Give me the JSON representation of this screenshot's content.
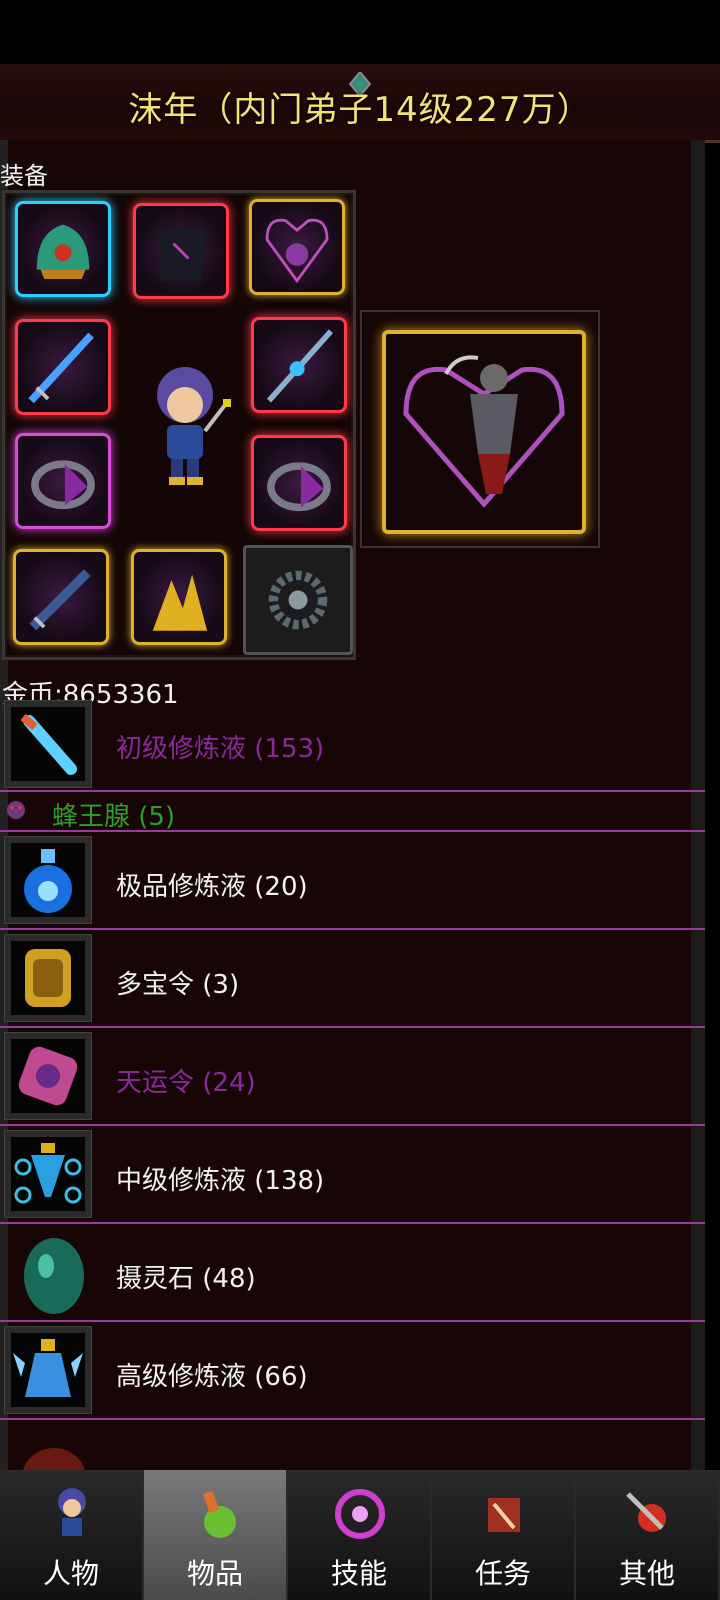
{
  "header": {
    "title": "沫年（内门弟子14级227万）"
  },
  "equipment": {
    "label": "装备"
  },
  "gold": {
    "text": "金币:8653361"
  },
  "items": [
    {
      "name": "初级修炼液 (153)",
      "color": "#8a2a9a",
      "icon": "blue-vial-icon"
    },
    {
      "name": "蜂王腺 (5)",
      "color": "#2aa02a",
      "icon": "bee-icon"
    },
    {
      "name": "极品修炼液 (20)",
      "color": "#f2f2f2",
      "icon": "blue-flask-icon"
    },
    {
      "name": "多宝令 (3)",
      "color": "#f2f2f2",
      "icon": "gold-token-icon"
    },
    {
      "name": "天运令 (24)",
      "color": "#8a2a9a",
      "icon": "pink-token-icon"
    },
    {
      "name": "中级修炼液 (138)",
      "color": "#f2f2f2",
      "icon": "bottle-orbs-icon"
    },
    {
      "name": "摄灵石 (48)",
      "color": "#f2f2f2",
      "icon": "green-egg-stone-icon"
    },
    {
      "name": "高级修炼液 (66)",
      "color": "#f2f2f2",
      "icon": "winged-flask-icon"
    }
  ],
  "tabs": [
    {
      "label": "人物",
      "icon": "character-icon"
    },
    {
      "label": "物品",
      "icon": "potion-bag-icon",
      "active": true
    },
    {
      "label": "技能",
      "icon": "skill-swirl-icon"
    },
    {
      "label": "任务",
      "icon": "quest-scroll-icon"
    },
    {
      "label": "其他",
      "icon": "sword-shield-icon"
    }
  ]
}
